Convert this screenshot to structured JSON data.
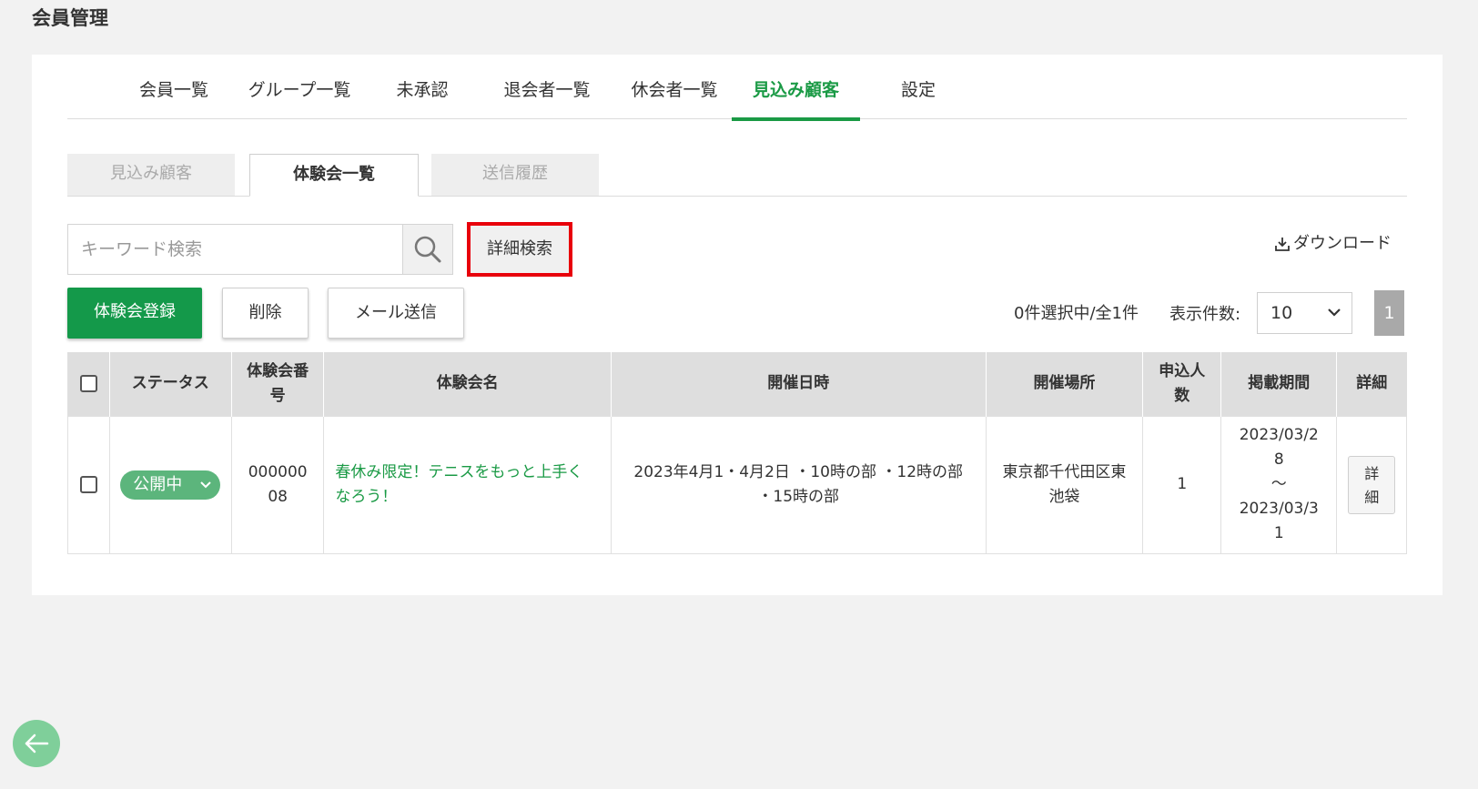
{
  "page": {
    "title": "会員管理"
  },
  "main_tabs": [
    {
      "label": "会員一覧"
    },
    {
      "label": "グループ一覧"
    },
    {
      "label": "未承認"
    },
    {
      "label": "退会者一覧"
    },
    {
      "label": "休会者一覧"
    },
    {
      "label": "見込み顧客",
      "active": true
    },
    {
      "label": "設定"
    }
  ],
  "sub_tabs": [
    {
      "label": "見込み顧客"
    },
    {
      "label": "体験会一覧",
      "active": true
    },
    {
      "label": "送信履歴"
    }
  ],
  "search": {
    "placeholder": "キーワード検索",
    "value": "",
    "icon": "search-icon"
  },
  "toolbar": {
    "detail_search_label": "詳細検索",
    "download_label": "ダウンロード",
    "register_label": "体験会登録",
    "delete_label": "削除",
    "mail_label": "メール送信",
    "selection_count": "0件選択中/全1件",
    "per_page_label": "表示件数:",
    "per_page_value": "10",
    "page_current": "1"
  },
  "table": {
    "headers": {
      "status": "ステータス",
      "number_line1": "体験会番",
      "number_line2": "号",
      "name": "体験会名",
      "datetime": "開催日時",
      "location": "開催場所",
      "applicants_line1": "申込人",
      "applicants_line2": "数",
      "period": "掲載期間",
      "detail": "詳細"
    },
    "rows": [
      {
        "status": "公開中",
        "number_line1": "000000",
        "number_line2": "08",
        "name_line1": "春休み限定！テニスをもっと上手く",
        "name_line2": "なろう！",
        "datetime_line1": "2023年4月1・4月2日 ・10時の部 ・12時の部",
        "datetime_line2": "・15時の部",
        "location_line1": "東京都千代田区東",
        "location_line2": "池袋",
        "applicants": "1",
        "period_start_line1": "2023/03/2",
        "period_start_line2": "8",
        "period_sep": "～",
        "period_end_line1": "2023/03/3",
        "period_end_line2": "1",
        "detail_line1": "詳",
        "detail_line2": "細"
      }
    ]
  },
  "colors": {
    "accent_green": "#14994a",
    "status_green": "#5cb57c",
    "highlight_red": "#e8000b"
  }
}
